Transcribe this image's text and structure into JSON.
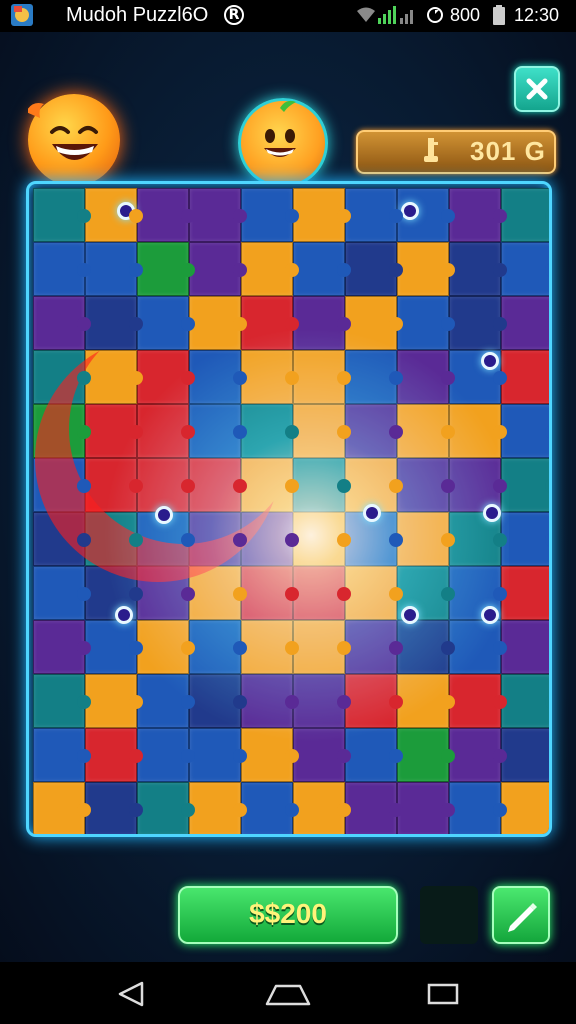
{
  "status_bar": {
    "app_title": "Mudoh Puzzl6O",
    "info_icon_glyph": "R",
    "signal_number": "800",
    "time": "12:30",
    "icons": [
      "app-icon",
      "info-icon",
      "wifi-icon",
      "signal-icon",
      "sync-icon",
      "battery-icon"
    ]
  },
  "header": {
    "close_icon": "close-icon",
    "coins_value": "301 G"
  },
  "board": {
    "colors": {
      "red": "#d8262e",
      "orange": "#f2a11e",
      "blue": "#1f59b8",
      "navy": "#213a8c",
      "purple": "#5a2a96",
      "teal": "#137f86",
      "green": "#1c9c3b",
      "darkteal": "#17615f"
    },
    "pieces": [
      [
        "teal",
        "orange",
        "purple",
        "purple",
        "blue",
        "orange",
        "blue",
        "blue",
        "purple",
        "teal"
      ],
      [
        "blue",
        "blue",
        "green",
        "purple",
        "orange",
        "blue",
        "navy",
        "orange",
        "navy",
        "blue"
      ],
      [
        "purple",
        "navy",
        "blue",
        "orange",
        "red",
        "purple",
        "orange",
        "blue",
        "navy",
        "purple"
      ],
      [
        "teal",
        "orange",
        "red",
        "blue",
        "orange",
        "orange",
        "blue",
        "purple",
        "blue",
        "red"
      ],
      [
        "green",
        "red",
        "red",
        "blue",
        "teal",
        "orange",
        "purple",
        "orange",
        "orange",
        "blue"
      ],
      [
        "blue",
        "red",
        "red",
        "red",
        "orange",
        "teal",
        "orange",
        "purple",
        "purple",
        "teal"
      ],
      [
        "navy",
        "teal",
        "blue",
        "purple",
        "purple",
        "orange",
        "blue",
        "orange",
        "teal",
        "blue"
      ],
      [
        "blue",
        "navy",
        "purple",
        "orange",
        "red",
        "red",
        "orange",
        "teal",
        "blue",
        "red"
      ],
      [
        "purple",
        "blue",
        "orange",
        "blue",
        "orange",
        "orange",
        "purple",
        "navy",
        "blue",
        "purple"
      ],
      [
        "teal",
        "orange",
        "blue",
        "navy",
        "purple",
        "purple",
        "red",
        "orange",
        "red",
        "teal"
      ],
      [
        "blue",
        "red",
        "blue",
        "blue",
        "orange",
        "purple",
        "blue",
        "green",
        "purple",
        "navy"
      ],
      [
        "orange",
        "navy",
        "teal",
        "orange",
        "blue",
        "orange",
        "purple",
        "purple",
        "blue",
        "orange"
      ]
    ]
  },
  "footer": {
    "price_label": "$$200",
    "edit_icon": "pencil-icon"
  },
  "nav": {
    "icons": [
      "back-icon",
      "home-icon",
      "recent-apps-icon"
    ]
  }
}
